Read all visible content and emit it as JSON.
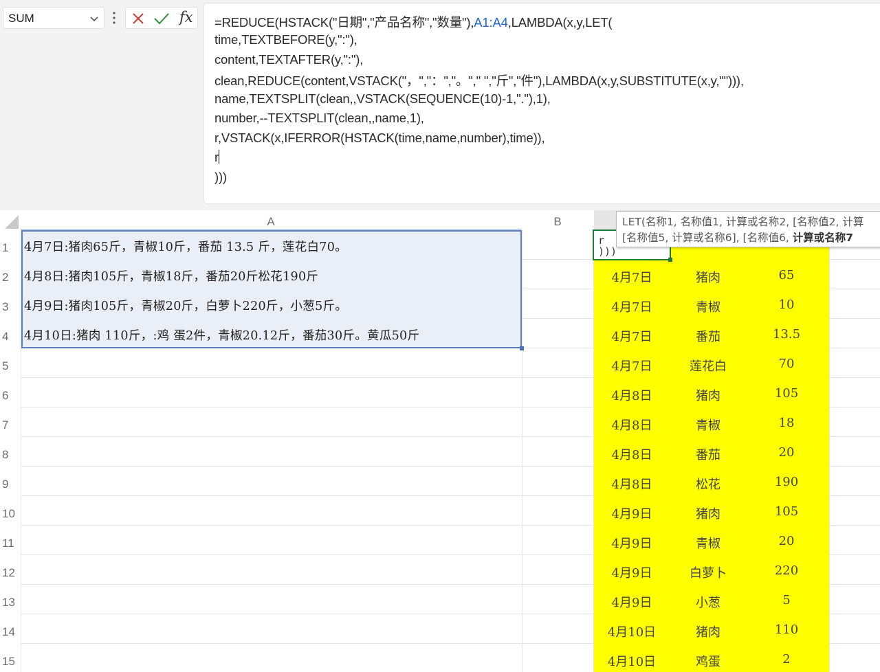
{
  "name_box": {
    "value": "SUM"
  },
  "formula_bar": {
    "lines": [
      {
        "segments": [
          {
            "t": "=REDUCE(HSTACK(\"日期\",\"产品名称\",\"数量\"),",
            "c": ""
          },
          {
            "t": "A1:A4",
            "c": "fref"
          },
          {
            "t": ",LAMBDA(x,y,LET(",
            "c": ""
          }
        ]
      },
      {
        "segments": [
          {
            "t": "time,TEXTBEFORE(y,\":\"),",
            "c": ""
          }
        ]
      },
      {
        "segments": [
          {
            "t": "content,TEXTAFTER(y,\":\"),",
            "c": ""
          }
        ]
      },
      {
        "segments": [
          {
            "t": "clean,REDUCE(content,VSTACK(\"，\",\"：\",\"。\",\" \",\"斤\",\"件\"),LAMBDA(x,y,SUBSTITUTE(x,y,\"\"))),",
            "c": ""
          }
        ]
      },
      {
        "segments": [
          {
            "t": "name,TEXTSPLIT(clean,,VSTACK(SEQUENCE(10)-1,\".\"),1),",
            "c": ""
          }
        ]
      },
      {
        "segments": [
          {
            "t": "number,--TEXTSPLIT(clean,,name,1),",
            "c": ""
          }
        ]
      },
      {
        "segments": [
          {
            "t": "r,VSTACK(x,IFERROR(HSTACK(time,name,number),time)),",
            "c": ""
          }
        ]
      },
      {
        "segments": [
          {
            "t": "r",
            "c": ""
          }
        ]
      },
      {
        "segments": [
          {
            "t": ")))",
            "c": ""
          }
        ]
      }
    ]
  },
  "columns": [
    "A",
    "B"
  ],
  "rows": [
    "1",
    "2",
    "3",
    "4",
    "5",
    "6",
    "7",
    "8",
    "9",
    "10",
    "11",
    "12",
    "13",
    "14",
    "15"
  ],
  "column_a": [
    "4月7日:猪肉65斤，青椒10斤，番茄 13.5 斤，莲花白70。",
    "4月8日:猪肉105斤，青椒18斤，番茄20斤松花190斤",
    "4月9日:猪肉105斤，青椒20斤，白萝卜220斤，小葱5斤。",
    "4月10日:猪肉 110斤，:鸡 蛋2件，青椒20.12斤，番茄30斤。黄瓜50斤"
  ],
  "active_cell_text": "r\n)))",
  "result_rows": [
    [
      "4月7日",
      "猪肉",
      "65"
    ],
    [
      "4月7日",
      "青椒",
      "10"
    ],
    [
      "4月7日",
      "番茄",
      "13.5"
    ],
    [
      "4月7日",
      "莲花白",
      "70"
    ],
    [
      "4月8日",
      "猪肉",
      "105"
    ],
    [
      "4月8日",
      "青椒",
      "18"
    ],
    [
      "4月8日",
      "番茄",
      "20"
    ],
    [
      "4月8日",
      "松花",
      "190"
    ],
    [
      "4月9日",
      "猪肉",
      "105"
    ],
    [
      "4月9日",
      "青椒",
      "20"
    ],
    [
      "4月9日",
      "白萝卜",
      "220"
    ],
    [
      "4月9日",
      "小葱",
      "5"
    ],
    [
      "4月10日",
      "猪肉",
      "110"
    ],
    [
      "4月10日",
      "鸡蛋",
      "2"
    ]
  ],
  "tooltip": {
    "line1": "LET(名称1, 名称值1, 计算或名称2, [名称值2, 计算",
    "line2_prefix": "[名称值5, 计算或名称6], [名称值6, ",
    "line2_bold": "计算或名称7"
  },
  "colors": {
    "result_fill": "#ffff00",
    "selection_fill": "#e9eef7",
    "active_border": "#1e7a3c",
    "ref_blue": "#1f66d6"
  }
}
